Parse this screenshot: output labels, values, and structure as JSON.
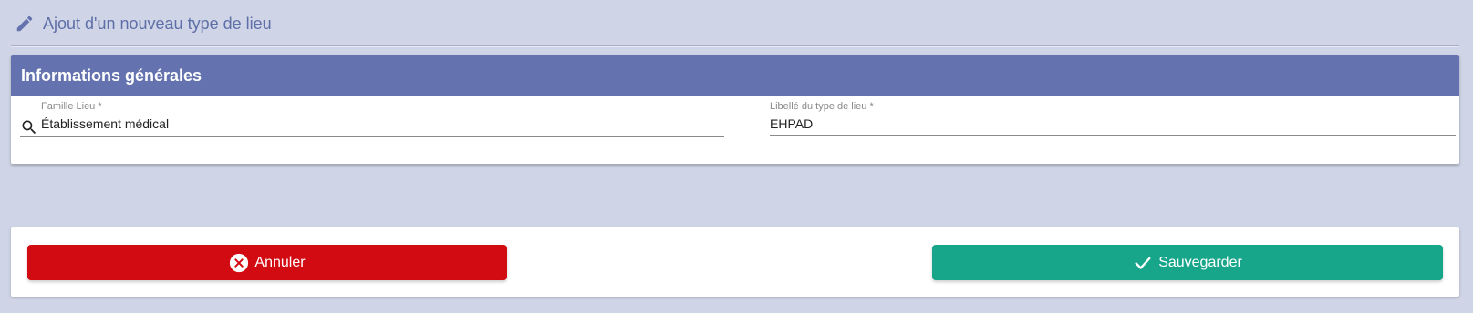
{
  "header": {
    "title": "Ajout d'un nouveau type de lieu",
    "icon": "pencil-icon"
  },
  "section": {
    "title": "Informations générales"
  },
  "fields": {
    "famille": {
      "label": "Famille Lieu *",
      "value": "Établissement médical",
      "icon": "search-icon"
    },
    "libelle": {
      "label": "Libellé du type de lieu *",
      "value": "EHPAD"
    }
  },
  "actions": {
    "cancel_label": "Annuler",
    "cancel_icon": "close-circle-icon",
    "save_label": "Sauvegarder",
    "save_icon": "check-icon"
  },
  "colors": {
    "background": "#cfd5e6",
    "accent": "#6473af",
    "cancel": "#d20a11",
    "save": "#18a68b"
  }
}
